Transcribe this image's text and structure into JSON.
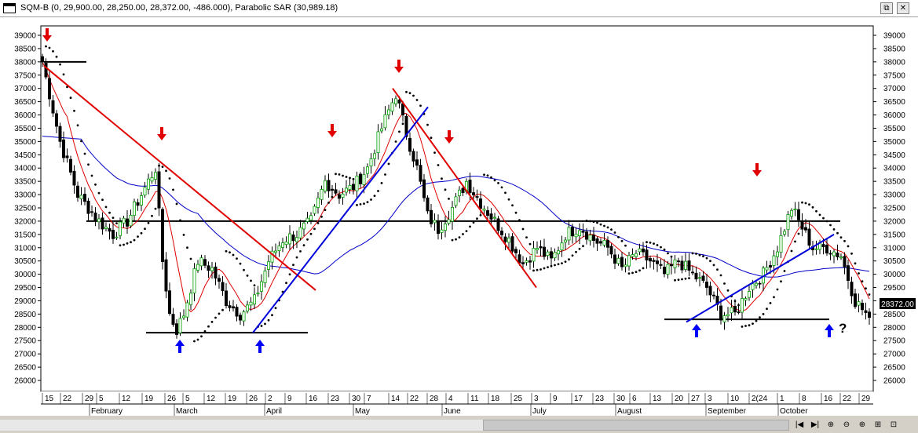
{
  "window": {
    "title": "SQM-B (0, 29,900.00, 28,250.00, 28,372.00, -486.000), Parabolic SAR (30,989.18)",
    "restore_glyph": "⧉",
    "close_glyph": "✕"
  },
  "chart_data": {
    "type": "candlestick",
    "symbol": "SQM-B",
    "ylim": [
      26000,
      39300
    ],
    "y_ticks": [
      26000,
      26500,
      27000,
      27500,
      28000,
      28500,
      29000,
      29500,
      30000,
      30500,
      31000,
      31500,
      32000,
      32500,
      33000,
      33500,
      34000,
      34500,
      35000,
      35500,
      36000,
      36500,
      37000,
      37500,
      38000,
      38500,
      39000
    ],
    "x_day_labels": [
      "15",
      "22",
      "29",
      "5",
      "12",
      "19",
      "26",
      "5",
      "12",
      "19",
      "26",
      "2",
      "9",
      "16",
      "23",
      "30",
      "7",
      "14",
      "22",
      "28",
      "4",
      "11",
      "18",
      "25",
      "3",
      "9",
      "17",
      "23",
      "30",
      "6",
      "13",
      "20",
      "27",
      "3",
      "10",
      "2(24",
      "1",
      "8",
      "16",
      "22",
      "29"
    ],
    "x_month_labels": [
      "February",
      "March",
      "April",
      "May",
      "June",
      "July",
      "August",
      "September",
      "October"
    ],
    "last_price_label": "28372.00",
    "annotation_text": "?",
    "horizontal_levels": [
      38000,
      32000,
      27800,
      28300
    ],
    "overlays": [
      "Parabolic SAR",
      "moving average (blue)",
      "moving average (red)",
      "trendlines",
      "signal arrows"
    ],
    "colors": {
      "up": "#00a000",
      "down": "#000000",
      "sar": "#000000",
      "ma_long": "#0000c8",
      "ma_short": "#e00000",
      "trend_red": "#e00000",
      "trend_blue": "#0000dd",
      "sell_arrow": "#e00000",
      "buy_arrow": "#0000ff"
    },
    "anchors": [
      [
        0,
        38000
      ],
      [
        5,
        35000
      ],
      [
        10,
        33000
      ],
      [
        16,
        32000
      ],
      [
        20,
        31500
      ],
      [
        24,
        32000
      ],
      [
        28,
        33000
      ],
      [
        32,
        34000
      ],
      [
        34,
        30500
      ],
      [
        36,
        28500
      ],
      [
        38,
        27900
      ],
      [
        40,
        28500
      ],
      [
        44,
        30500
      ],
      [
        48,
        30200
      ],
      [
        52,
        29000
      ],
      [
        56,
        28500
      ],
      [
        60,
        29000
      ],
      [
        64,
        30500
      ],
      [
        68,
        31300
      ],
      [
        72,
        31500
      ],
      [
        76,
        32000
      ],
      [
        80,
        33500
      ],
      [
        84,
        33000
      ],
      [
        88,
        33300
      ],
      [
        92,
        34000
      ],
      [
        96,
        35500
      ],
      [
        100,
        36800
      ],
      [
        103,
        35300
      ],
      [
        106,
        34000
      ],
      [
        109,
        32200
      ],
      [
        112,
        31700
      ],
      [
        116,
        32500
      ],
      [
        120,
        33500
      ],
      [
        124,
        32700
      ],
      [
        128,
        32000
      ],
      [
        132,
        31300
      ],
      [
        136,
        30400
      ],
      [
        140,
        31000
      ],
      [
        144,
        30500
      ],
      [
        148,
        31500
      ],
      [
        152,
        31800
      ],
      [
        156,
        31300
      ],
      [
        160,
        31000
      ],
      [
        164,
        30200
      ],
      [
        168,
        30800
      ],
      [
        172,
        30500
      ],
      [
        176,
        30000
      ],
      [
        180,
        30500
      ],
      [
        184,
        30000
      ],
      [
        188,
        29500
      ],
      [
        192,
        28500
      ],
      [
        196,
        28500
      ],
      [
        200,
        29500
      ],
      [
        204,
        30000
      ],
      [
        208,
        31000
      ],
      [
        212,
        32500
      ],
      [
        214,
        32000
      ],
      [
        218,
        31000
      ],
      [
        222,
        31000
      ],
      [
        226,
        30700
      ],
      [
        230,
        29000
      ],
      [
        234,
        28372
      ]
    ]
  }
}
